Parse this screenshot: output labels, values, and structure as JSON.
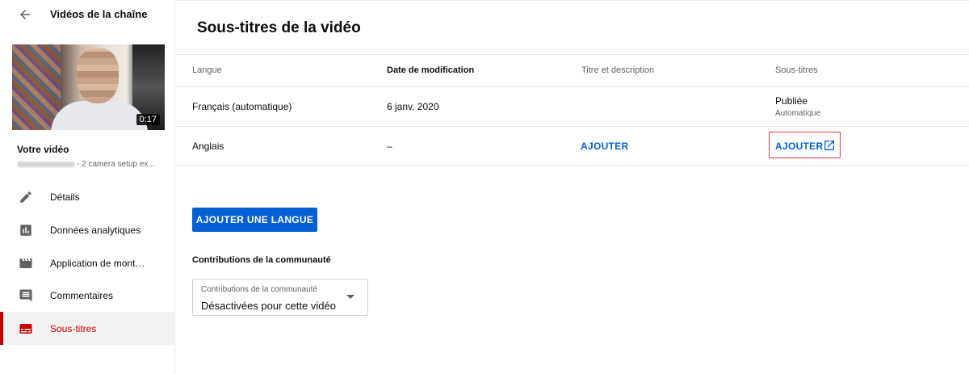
{
  "sidebar": {
    "back_icon": "arrow-left-icon",
    "title": "Vidéos de la chaîne",
    "video": {
      "duration": "0:17",
      "label": "Votre vidéo",
      "subtitle": "- 2 camera setup ex..."
    },
    "items": [
      {
        "label": "Détails",
        "icon": "pencil-icon"
      },
      {
        "label": "Données analytiques",
        "icon": "analytics-icon"
      },
      {
        "label": "Application de mont…",
        "icon": "clapperboard-icon"
      },
      {
        "label": "Commentaires",
        "icon": "comment-icon"
      },
      {
        "label": "Sous-titres",
        "icon": "subtitles-icon",
        "active": true
      }
    ]
  },
  "main": {
    "title": "Sous-titres de la vidéo",
    "table": {
      "headers": [
        "Langue",
        "Date de modification",
        "Titre et description",
        "Sous-titres"
      ],
      "rows": [
        {
          "language": "Français (automatique)",
          "date": "6 janv. 2020",
          "title_desc": "",
          "subtitles": "Publiée",
          "subtitles_sub": "Automatique"
        },
        {
          "language": "Anglais",
          "date": "–",
          "title_desc": "AJOUTER",
          "subtitles": "AJOUTER",
          "subtitles_icon": "open-external-icon"
        }
      ]
    },
    "add_language_button": "AJOUTER UNE LANGUE",
    "community": {
      "section_label": "Contributions de la communauté",
      "select_label": "Contributions de la communauté",
      "select_value": "Désactivées pour cette vidéo"
    }
  },
  "colors": {
    "accent_blue": "#065fd4",
    "active_red": "#cc0000",
    "highlight_border": "#e03b3b"
  }
}
